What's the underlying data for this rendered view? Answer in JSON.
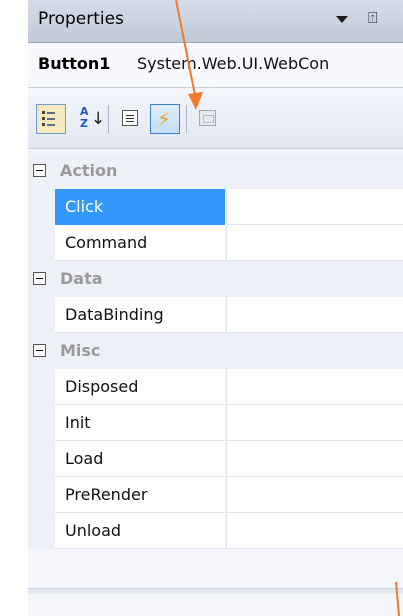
{
  "window": {
    "title": "Properties",
    "pin_glyph": "⍐"
  },
  "object_selector": {
    "name": "Button1",
    "type": "System.Web.UI.WebCon"
  },
  "toolbar": {
    "buttons": [
      {
        "icon": "categorized-icon",
        "state": "checked"
      },
      {
        "icon": "alphabetical-sort-icon",
        "state": "normal"
      },
      {
        "icon": "properties-icon",
        "state": "normal"
      },
      {
        "icon": "events-lightning-icon",
        "state": "active"
      },
      {
        "icon": "property-pages-icon",
        "state": "disabled"
      }
    ],
    "az_text": "A\nZ",
    "az_arrow": "↓",
    "bolt_glyph": "⚡"
  },
  "categories": [
    {
      "label": "Action",
      "events": [
        "Click",
        "Command"
      ]
    },
    {
      "label": "Data",
      "events": [
        "DataBinding"
      ]
    },
    {
      "label": "Misc",
      "events": [
        "Disposed",
        "Init",
        "Load",
        "PreRender",
        "Unload"
      ]
    }
  ],
  "selected_event": "Click",
  "colors": {
    "selection": "#3399ff",
    "annotation_arrow": "#f07a2a",
    "category_text": "#9a9a9a"
  }
}
